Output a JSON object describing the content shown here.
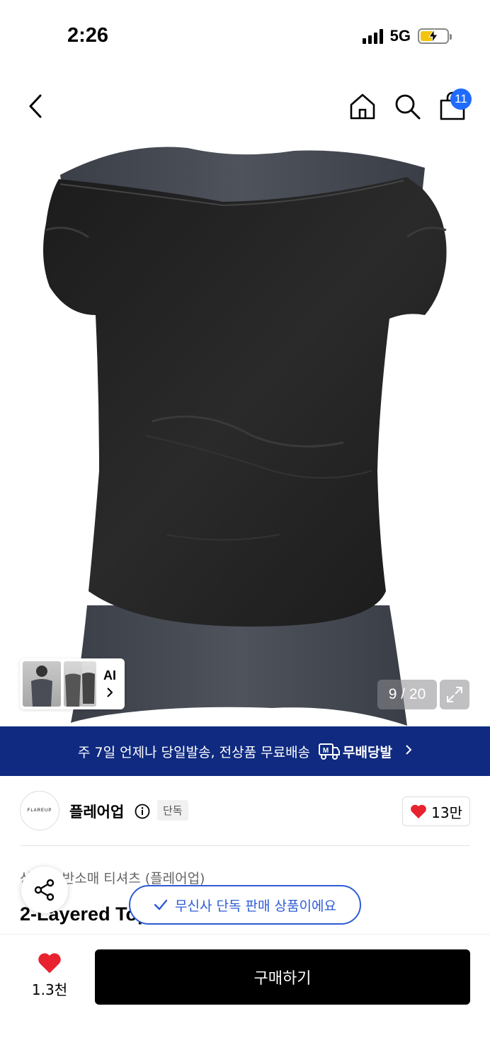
{
  "status_bar": {
    "time": "2:26",
    "network": "5G"
  },
  "nav": {
    "cart_badge": "11"
  },
  "gallery": {
    "ai_label": "AI",
    "page_counter": "9 / 20"
  },
  "banner": {
    "text": "주 7일 언제나 당일발송, 전상품 무료배송",
    "brand_mark": "M",
    "brand": "무배당발"
  },
  "brand": {
    "logo_text": "FLAREUP",
    "name": "플레어업",
    "tag": "단독",
    "likes": "13만"
  },
  "product": {
    "category_prefix": "상",
    "category": "반소매 티셔츠 (플레어업)",
    "title": "2-Layered Top (Charcoal)"
  },
  "toast": {
    "text": "무신사 단독 판매 상품이에요"
  },
  "bottom_bar": {
    "wish_count": "1.3천",
    "buy_label": "구매하기"
  },
  "colors": {
    "banner": "#0f2a80",
    "accent_blue": "#2d5bd7",
    "badge_blue": "#1f6bff",
    "heart_red": "#e8222e",
    "battery": "#f2c40c"
  }
}
